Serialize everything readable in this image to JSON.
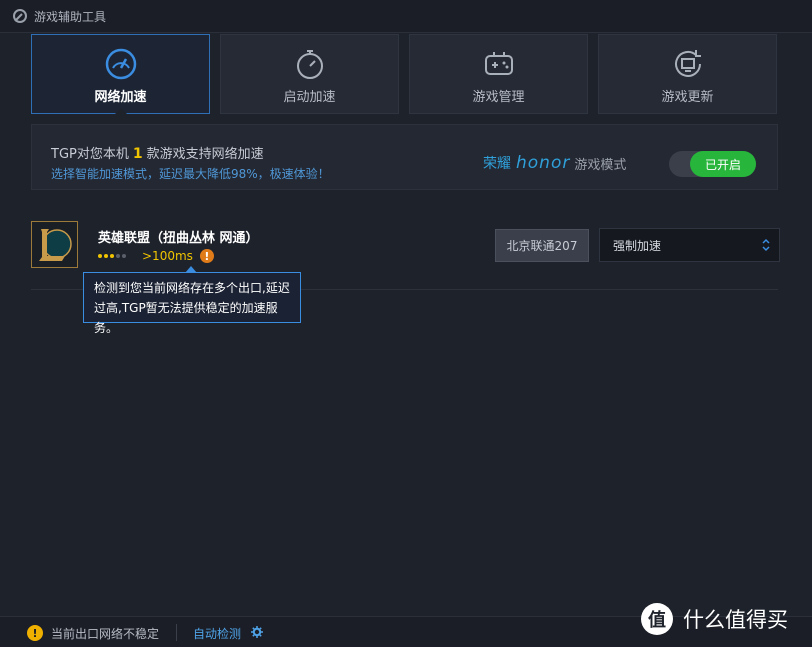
{
  "window": {
    "title": "游戏辅助工具"
  },
  "tabs": [
    {
      "label": "网络加速",
      "icon": "speedometer-icon",
      "active": true
    },
    {
      "label": "启动加速",
      "icon": "stopwatch-icon",
      "active": false
    },
    {
      "label": "游戏管理",
      "icon": "gamepad-icon",
      "active": false
    },
    {
      "label": "游戏更新",
      "icon": "refresh-monitor-icon",
      "active": false
    }
  ],
  "banner": {
    "prefix": "TGP对您本机",
    "count": "1",
    "suffix": "款游戏支持网络加速",
    "subtitle": "选择智能加速模式，延迟最大降低98%，极速体验！",
    "partner_cn": "荣耀",
    "partner_logo": "honor",
    "partner_mode": "游戏模式",
    "toggle_label": "已开启"
  },
  "game": {
    "name": "英雄联盟（扭曲丛林 网通）",
    "ping": ">100ms",
    "signal_level": "3 of 5",
    "server": "北京联通207",
    "mode_selected": "强制加速",
    "tooltip": "检测到您当前网络存在多个出口,延迟过高,TGP暂无法提供稳定的加速服务。"
  },
  "status": {
    "message": "当前出口网络不稳定",
    "auto_detect": "自动检测"
  },
  "watermark": {
    "symbol": "值",
    "text": "什么值得买"
  },
  "colors": {
    "accent": "#2e6fb5",
    "toggle_on": "#27b53b",
    "warning": "#e07b1a",
    "highlight": "#f0c400"
  }
}
